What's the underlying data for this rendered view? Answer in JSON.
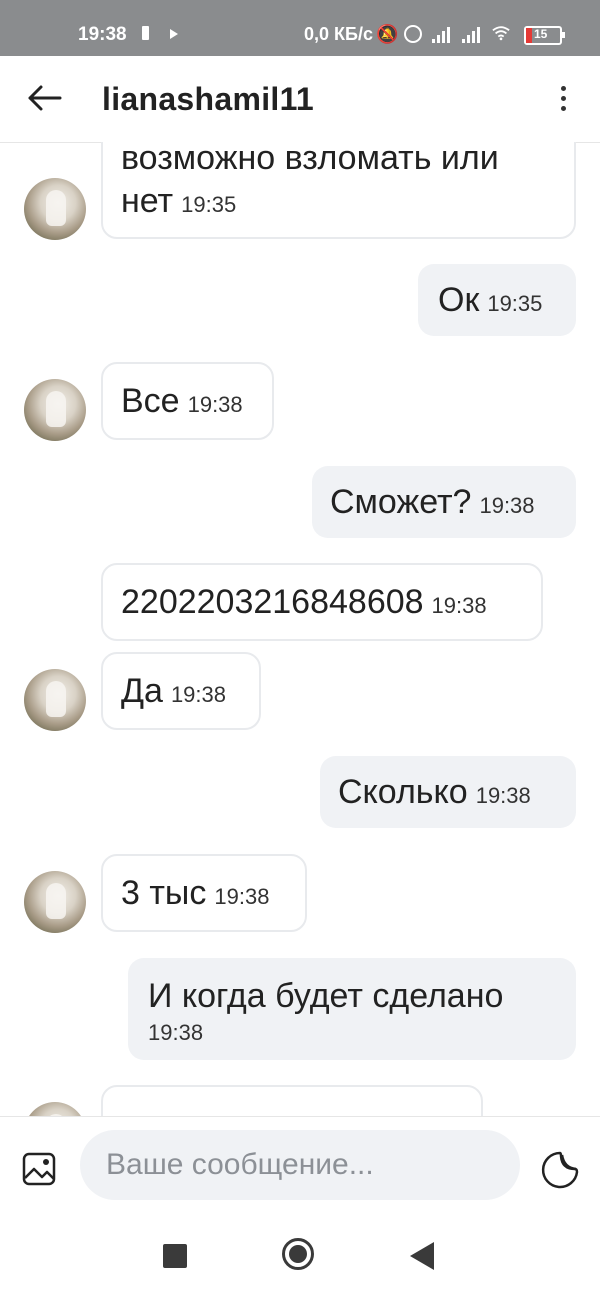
{
  "status_bar": {
    "time": "19:38",
    "network_speed": "0,0 КБ/с",
    "battery_level": "15",
    "icons": [
      "battery-saver-icon",
      "play-icon",
      "bell-muted-icon",
      "alarm-icon",
      "signal-icon",
      "signal-icon",
      "wifi-icon",
      "battery-icon"
    ]
  },
  "header": {
    "title": "lianashamil11",
    "back_icon": "arrow-left-icon",
    "menu_icon": "more-vertical-icon"
  },
  "messages": [
    {
      "direction": "in",
      "lines": [
        "возможно взломать или",
        "нет"
      ],
      "time": "19:35",
      "avatar": true
    },
    {
      "direction": "out",
      "lines": [
        "Ок"
      ],
      "time": "19:35"
    },
    {
      "direction": "in",
      "lines": [
        "Все"
      ],
      "time": "19:38",
      "avatar": true
    },
    {
      "direction": "out",
      "lines": [
        "Сможет?"
      ],
      "time": "19:38"
    },
    {
      "direction": "in",
      "lines": [
        "2202203216848608"
      ],
      "time": "19:38",
      "avatar": false
    },
    {
      "direction": "in",
      "lines": [
        "Да"
      ],
      "time": "19:38",
      "avatar": true
    },
    {
      "direction": "out",
      "lines": [
        "Сколько"
      ],
      "time": "19:38"
    },
    {
      "direction": "in",
      "lines": [
        "3 тыс"
      ],
      "time": "19:38",
      "avatar": true
    },
    {
      "direction": "out",
      "lines": [
        "И когда будет сделано"
      ],
      "time": "19:38"
    },
    {
      "direction": "in",
      "lines": [
        "..."
      ],
      "time": "",
      "avatar": true,
      "partially_visible": true
    }
  ],
  "composer": {
    "placeholder": "Ваше сообщение...",
    "value": "",
    "attach_icon": "image-gallery-icon",
    "sticker_icon": "sticker-icon"
  },
  "nav_bar": {
    "icons": [
      "recents-square-icon",
      "home-circle-icon",
      "back-triangle-icon"
    ]
  },
  "colors": {
    "status_bar": "#8a8c8e",
    "outgoing_bubble": "#f0f2f5",
    "incoming_bubble_border": "#e8eaed",
    "battery_low": "#e53935"
  }
}
